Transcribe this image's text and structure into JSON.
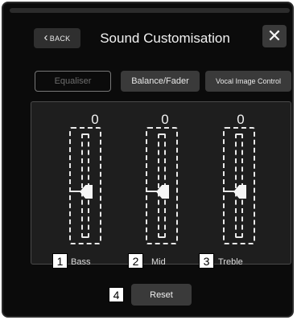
{
  "header": {
    "back_label": "BACK",
    "title": "Sound Customisation",
    "close_symbol": "✕"
  },
  "tabs": [
    {
      "label": "Equaliser",
      "active": true
    },
    {
      "label": "Balance/Fader",
      "active": false
    },
    {
      "label": "Vocal Image Control",
      "active": false
    }
  ],
  "sliders": [
    {
      "label": "Bass",
      "value": "0",
      "callout": "1"
    },
    {
      "label": "Mid",
      "value": "0",
      "callout": "2"
    },
    {
      "label": "Treble",
      "value": "0",
      "callout": "3"
    }
  ],
  "reset": {
    "label": "Reset",
    "callout": "4"
  },
  "colors": {
    "background": "#0b0b0b",
    "button": "#3a3a3a",
    "panel": "#1e1e1e",
    "text": "#f2f2f2"
  }
}
